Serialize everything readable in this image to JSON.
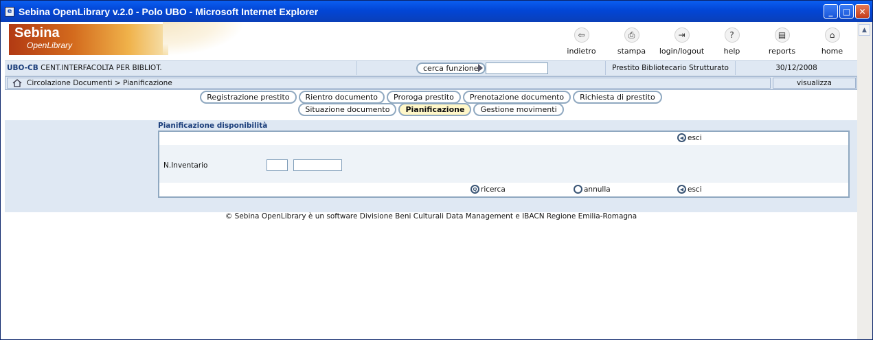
{
  "window": {
    "title": "Sebina OpenLibrary v.2.0 - Polo UBO - Microsoft Internet Explorer",
    "controls": {
      "minimize": "_",
      "maximize": "□",
      "close": "✕"
    }
  },
  "banner": {
    "logo_line1": "Sebina",
    "logo_line2": "OpenLibrary",
    "nav": [
      {
        "label": "indietro",
        "icon": "back-icon",
        "glyph": "⇦"
      },
      {
        "label": "stampa",
        "icon": "printer-icon",
        "glyph": "⎙"
      },
      {
        "label": "login/logout",
        "icon": "login-icon",
        "glyph": "⇥"
      },
      {
        "label": "help",
        "icon": "help-icon",
        "glyph": "?"
      },
      {
        "label": "reports",
        "icon": "reports-icon",
        "glyph": "▤"
      },
      {
        "label": "home",
        "icon": "home-icon",
        "glyph": "⌂"
      }
    ]
  },
  "infobar": {
    "library_code": "UBO-CB",
    "library_name": "CENT.INTERFACOLTA PER BIBLIOT.",
    "search_button": "cerca funzione",
    "search_value": "",
    "user_role": "Prestito Bibliotecario Strutturato",
    "date": "30/12/2008"
  },
  "breadcrumb": {
    "text": "Circolazione Documenti > Pianificazione",
    "view_button": "visualizza"
  },
  "tabs_row1": [
    {
      "label": "Registrazione prestito"
    },
    {
      "label": "Rientro documento"
    },
    {
      "label": "Proroga prestito"
    },
    {
      "label": "Prenotazione documento"
    },
    {
      "label": "Richiesta di prestito"
    }
  ],
  "tabs_row2": [
    {
      "label": "Situazione documento"
    },
    {
      "label": "Pianificazione",
      "active": true
    },
    {
      "label": "Gestione movimenti"
    }
  ],
  "panel": {
    "title": "Pianificazione disponibilità",
    "exit_top": "esci",
    "inventory_label": "N.Inventario",
    "inventory_prefix": "",
    "inventory_number": "",
    "search_button": "ricerca",
    "cancel_button": "annulla",
    "exit_bottom": "esci"
  },
  "footer": {
    "text": "© Sebina OpenLibrary è un software   Divisione Beni Culturali Data Management  e  IBACN Regione Emilia-Romagna"
  },
  "colors": {
    "titlebar": "#0246d6",
    "panel_bg": "#dfe8f3",
    "border": "#8fa8c0",
    "active_tab": "#fff7c8",
    "label_blue": "#1a3d7a"
  }
}
